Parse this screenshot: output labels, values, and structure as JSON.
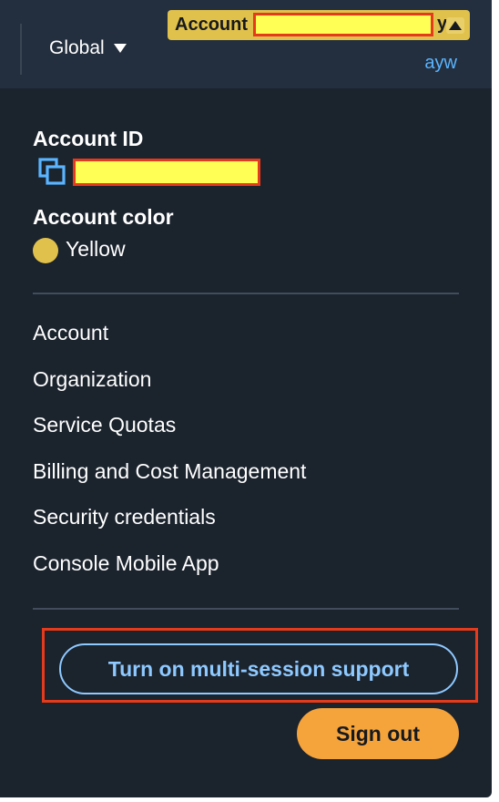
{
  "topbar": {
    "region_label": "Global",
    "account_label": "Account",
    "account_name_tail": "y",
    "username": "ayw"
  },
  "panel": {
    "account_id_heading": "Account ID",
    "account_color_heading": "Account color",
    "account_color_name": "Yellow",
    "account_color_hex": "#e0c14b",
    "menu_items": [
      "Account",
      "Organization",
      "Service Quotas",
      "Billing and Cost Management",
      "Security credentials",
      "Console Mobile App"
    ],
    "multi_session_label": "Turn on multi-session support",
    "sign_out_label": "Sign out"
  },
  "colors": {
    "nav_bg": "#232f3e",
    "panel_bg": "#1b232d",
    "link_blue": "#5ab4ff",
    "button_outline": "#8ec9ff",
    "sign_out_bg": "#f5a33b",
    "redaction_fill": "#ffff55",
    "redaction_border": "#e53b1c"
  },
  "icons": {
    "region_caret": "caret-down-icon",
    "account_caret": "caret-up-icon",
    "copy": "copy-icon"
  }
}
